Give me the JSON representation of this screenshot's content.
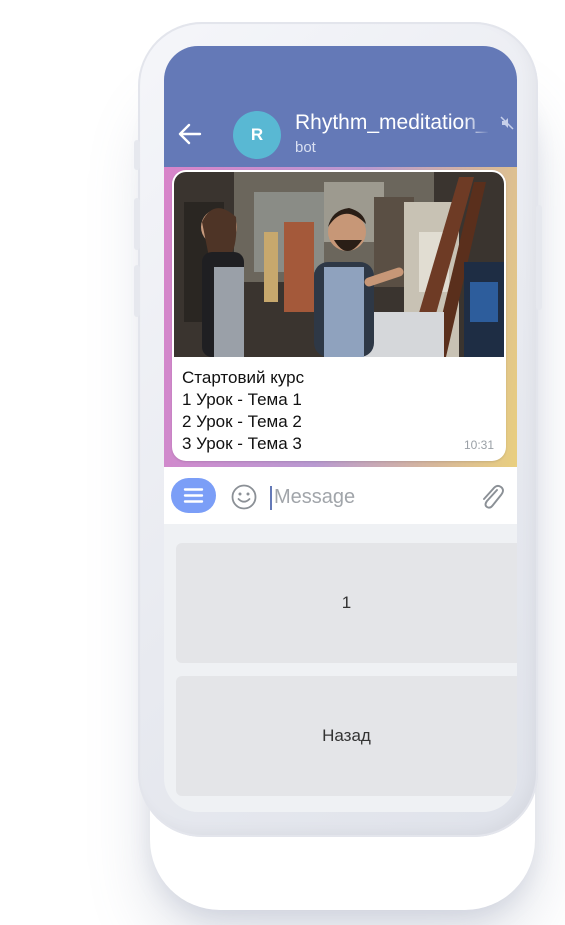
{
  "header": {
    "title": "Rhythm_meditation_bot",
    "subtitle": "bot",
    "avatar_letter": "R"
  },
  "message": {
    "lines": [
      "Стартовий курс",
      "1 Урок - Тема 1",
      "2 Урок - Тема 2",
      "3 Урок - Тема 3"
    ],
    "time": "10:31",
    "photo": "photo of two artists painting at an easel in a studio"
  },
  "input": {
    "placeholder": "Message"
  },
  "keyboard": {
    "buttons": [
      "1",
      "Назад"
    ]
  },
  "icons": {
    "back": "arrow-left-icon",
    "mute": "mute-icon",
    "menu": "menu-icon",
    "emoji": "smile-icon",
    "attach": "paperclip-icon"
  },
  "colors": {
    "header": "#6479b7",
    "avatar": "#59b8d3",
    "menu_button": "#7b9ef7",
    "keyboard_button": "#e4e5e8"
  }
}
